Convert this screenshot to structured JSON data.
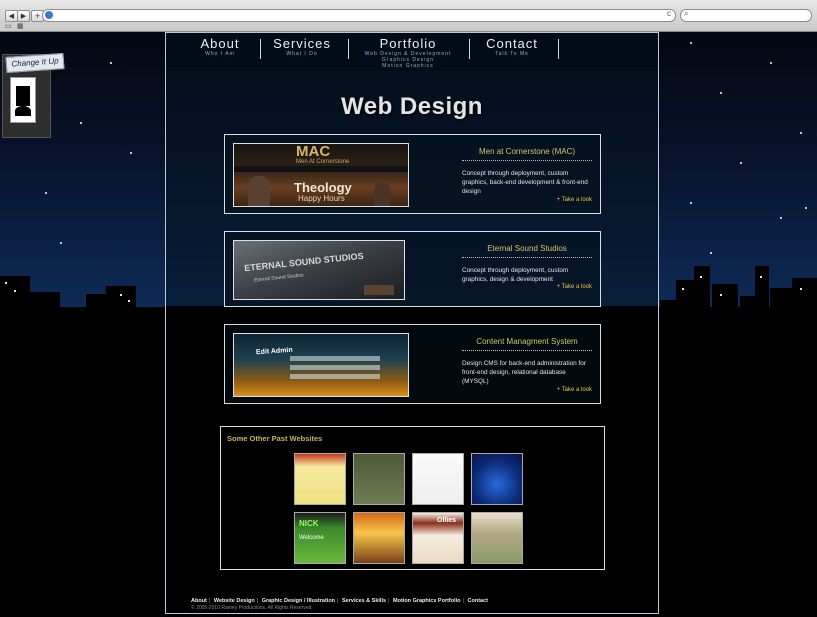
{
  "browser": {
    "back": "◀",
    "forward": "▶",
    "add": "+",
    "reload": "c",
    "search_icon": "magnifier-icon"
  },
  "widget": {
    "tag": "Change It Up"
  },
  "nav": {
    "items": [
      {
        "title": "About",
        "subtitle": "Who I Am"
      },
      {
        "title": "Services",
        "subtitle": "What I Do"
      },
      {
        "title": "Portfolio",
        "subtitle": "Web Design & Development",
        "sub2": "Graphics Design",
        "sub3": "Motion Graphics"
      },
      {
        "title": "Contact",
        "subtitle": "Talk To Me"
      }
    ]
  },
  "page": {
    "heading": "Web Design"
  },
  "projects": [
    {
      "title": "Men at Cornerstone (MAC)",
      "desc": "Concept through deployment, custom graphics, back-end development & front-end design",
      "link": "+ Take a look",
      "shot_title": "MAC",
      "shot_sub": "Men At Cornerstone",
      "shot_text": "Theology",
      "shot_text2": "Happy Hours"
    },
    {
      "title": "Eternal Sound Studios",
      "desc": "Concept through deployment, custom graphics, design & development",
      "link": "+ Take a look",
      "shot_title": "ETERNAL SOUND STUDIOS",
      "shot_sub": "Eternal Sound Studios"
    },
    {
      "title": "Content Managment System",
      "desc": "Design CMS for back-end administration for front-end design, relational database (MYSQL)",
      "link": "+ Take a look",
      "shot_title": "Edit Admin"
    }
  ],
  "others": {
    "title": "Some Other Past Websites",
    "thumb_texts": [
      "NICK",
      "Welcome",
      "Ollies"
    ]
  },
  "footer": {
    "links": [
      "About",
      "Website Design",
      "Graphic Design / Illustration",
      "Services & Skills",
      "Motion Graphics Portfolio",
      "Contact"
    ],
    "copyright": "© 2005-2010 Ramey Productions. All Rights Reserved."
  },
  "colors": {
    "accent_gold": "#d4c56d",
    "sky_blue": "#3e9fdc",
    "panel_border": "#bfc8d2"
  }
}
